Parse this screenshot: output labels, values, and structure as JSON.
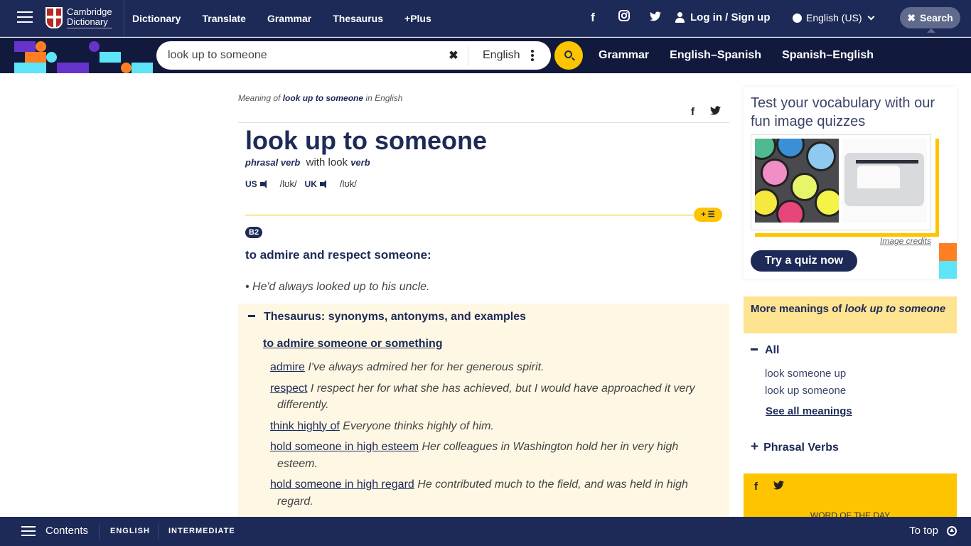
{
  "header": {
    "logo_line1": "Cambridge",
    "logo_line2": "Dictionary",
    "nav": [
      "Dictionary",
      "Translate",
      "Grammar",
      "Thesaurus",
      "+Plus"
    ],
    "social": {
      "facebook": "f",
      "instagram": "◎",
      "twitter": "🐦"
    },
    "login": "Log in / Sign up",
    "language": "English (US)",
    "search_toggle": "Search"
  },
  "search": {
    "value": "look up to someone",
    "dictionary": "English",
    "subnav": [
      "Grammar",
      "English–Spanish",
      "Spanish–English"
    ]
  },
  "entry": {
    "meaning_prefix": "Meaning of ",
    "meaning_word": "look up to someone",
    "meaning_suffix": " in English",
    "headword": "look up to someone",
    "pos": "phrasal verb",
    "with_text": "with look",
    "with_pos": "verb",
    "pron": [
      {
        "region": "US",
        "ipa": "/lʊk/"
      },
      {
        "region": "UK",
        "ipa": "/lʊk/"
      }
    ],
    "add_to_list": "+ ☰",
    "level": "B2",
    "definition": "to admire and respect someone:",
    "example": "• He'd always looked up to his uncle."
  },
  "thesaurus": {
    "heading": "Thesaurus: synonyms, antonyms, and examples",
    "subheading": "to admire someone or something",
    "items": [
      {
        "word": "admire",
        "example": "I've always admired her for her generous spirit."
      },
      {
        "word": "respect",
        "example": "I respect her for what she has achieved, but I would have approached it very differently."
      },
      {
        "word": "think highly of",
        "example": "Everyone thinks highly of him."
      },
      {
        "word": "hold someone in high esteem",
        "example": "Her colleagues in Washington hold her in very high esteem."
      },
      {
        "word": "hold someone in high regard",
        "example": "He contributed much to the field, and was held in high regard."
      }
    ]
  },
  "sidebar": {
    "quiz_title": "Test your vocabulary with our fun image quizzes",
    "image_credits": "Image credits",
    "quiz_button": "Try a quiz now",
    "more_prefix": "More meanings of ",
    "more_word": "look up to someone",
    "all_label": "All",
    "links": [
      "look someone up",
      "look up someone"
    ],
    "see_all": "See all meanings",
    "phrasal_verbs": "Phrasal Verbs",
    "wotd_label": "WORD OF THE DAY"
  },
  "bottom": {
    "contents": "Contents",
    "tags": [
      "ENGLISH",
      "INTERMEDIATE"
    ],
    "to_top": "To top"
  },
  "colors": {
    "brand_navy": "#1d2a57",
    "accent_yellow": "#fec400",
    "thesaurus_bg": "#fef7e4",
    "more_meanings_bg": "#fee391"
  }
}
